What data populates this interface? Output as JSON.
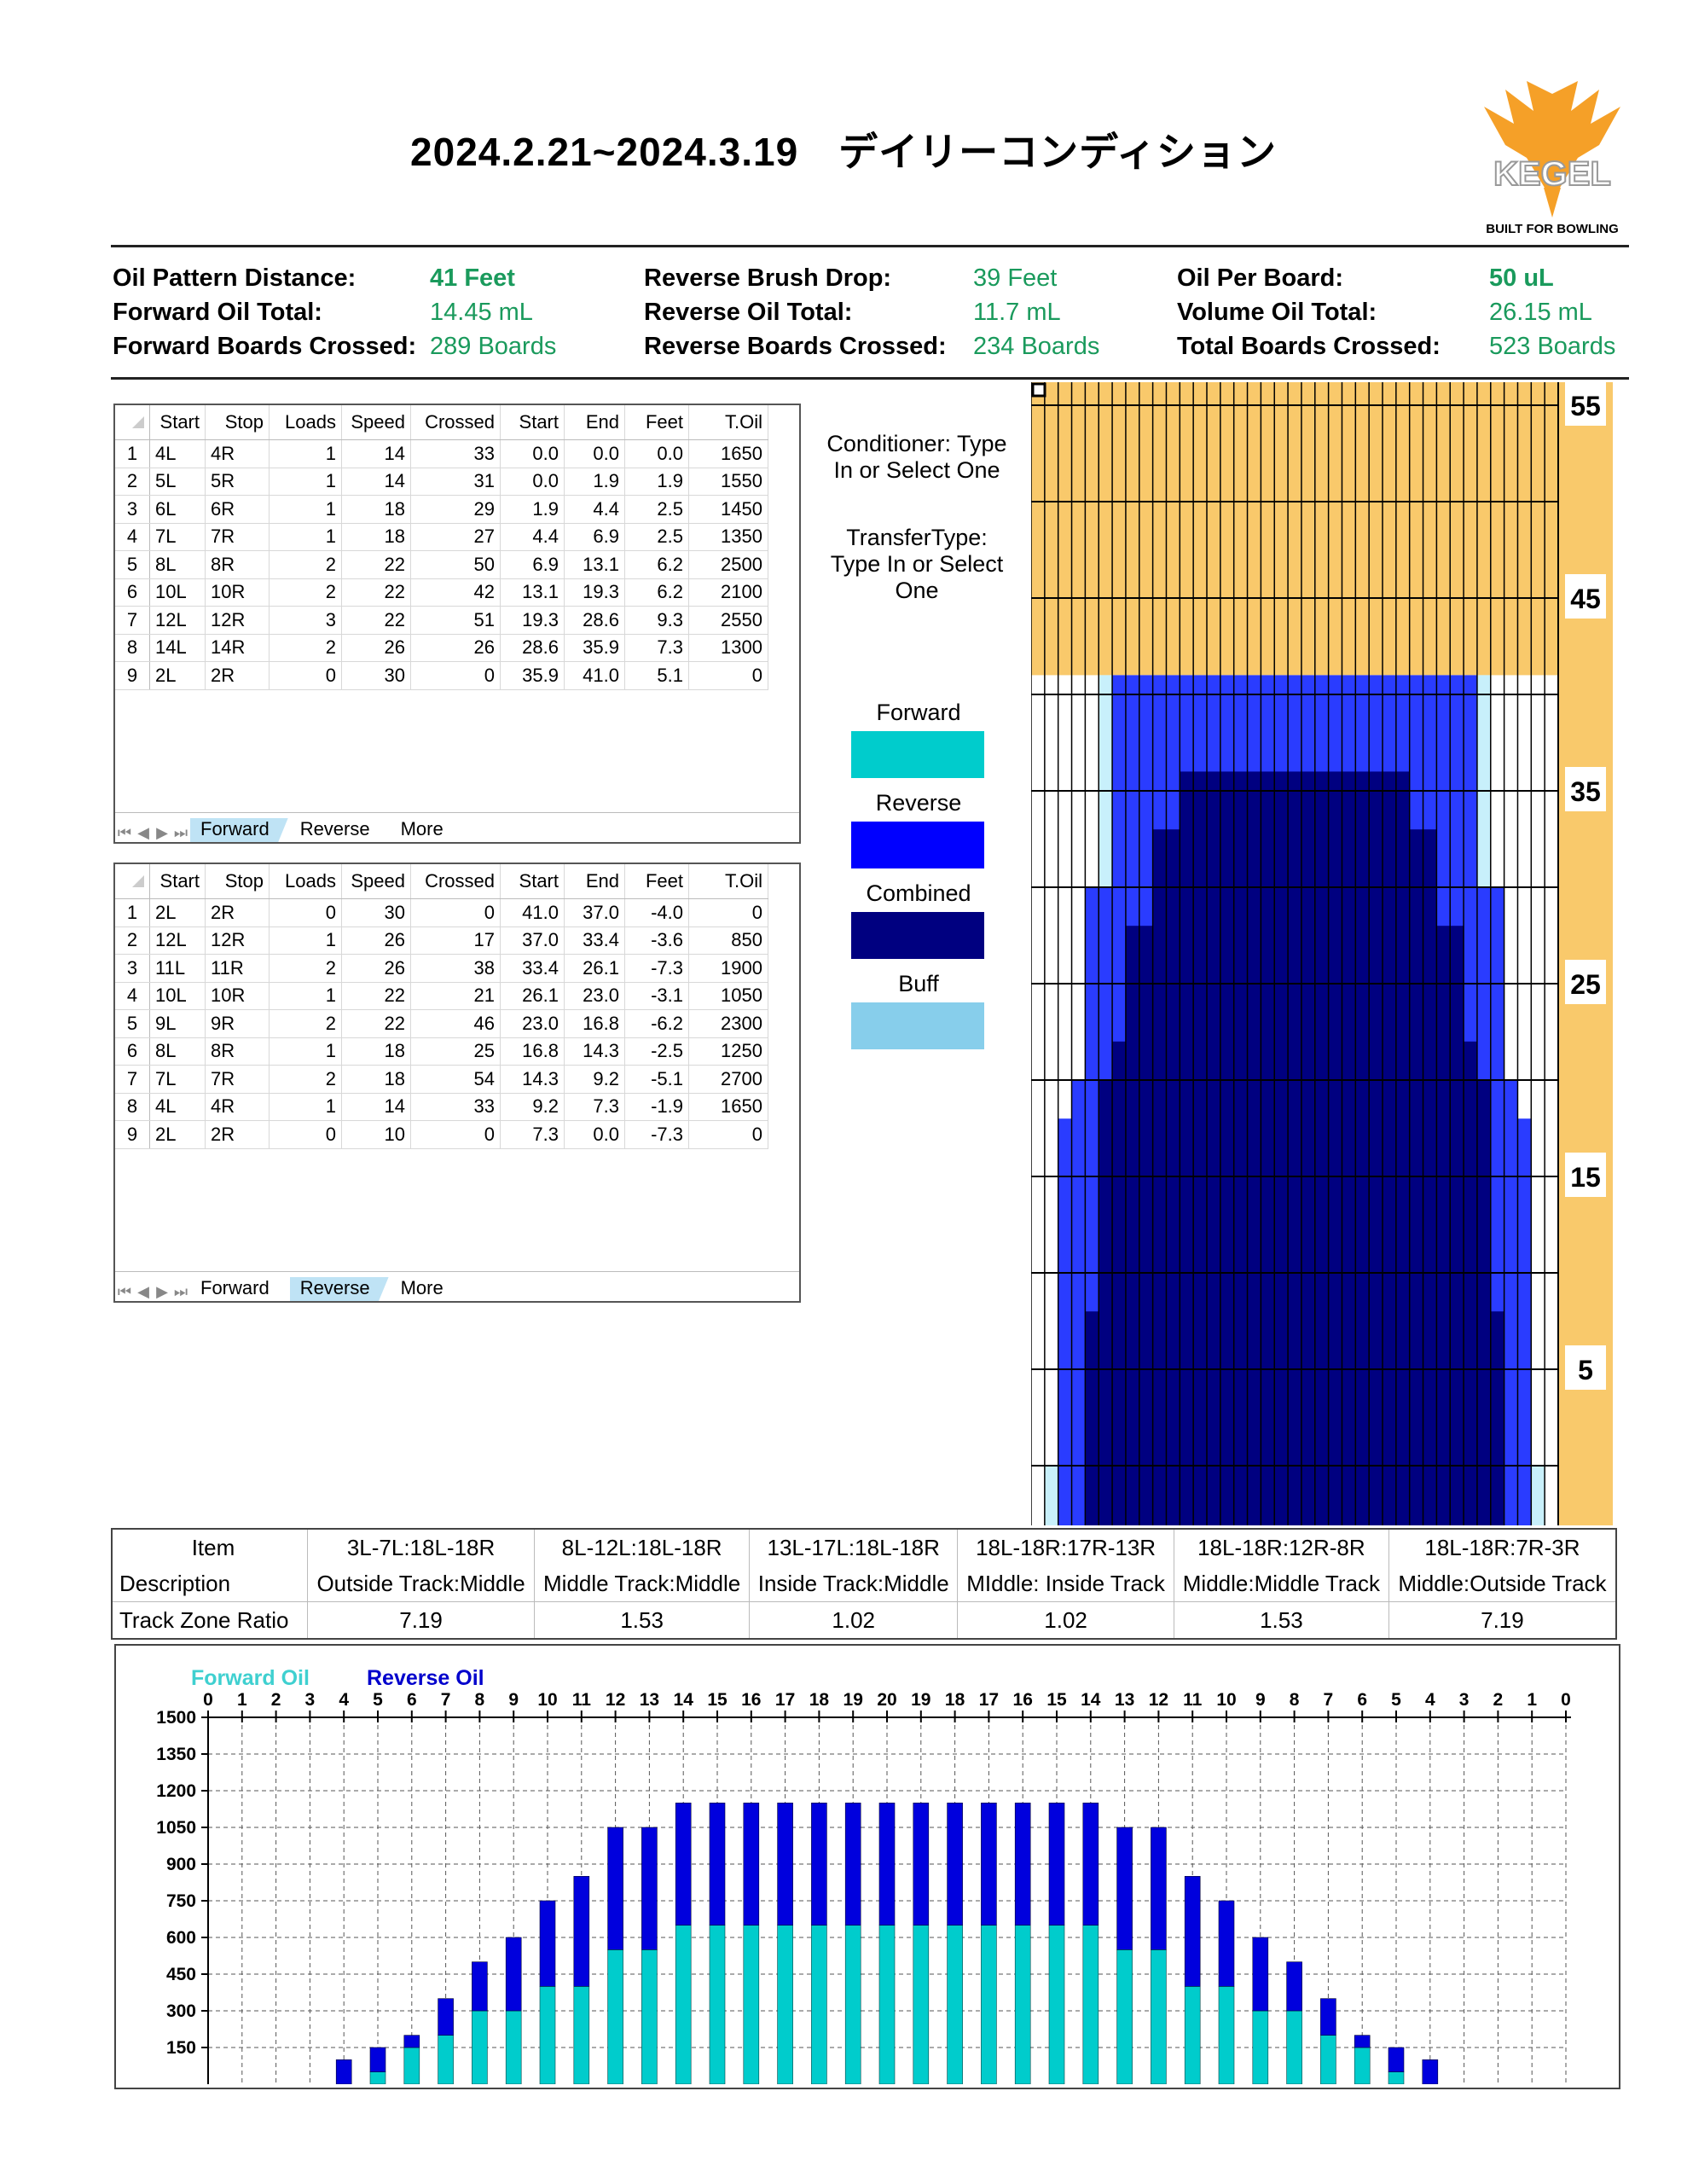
{
  "header": {
    "title": "2024.2.21~2024.3.19　デイリーコンディション",
    "logo_text": "KEGEL",
    "logo_tagline": "BUILT FOR BOWLING"
  },
  "summary": {
    "col1": [
      {
        "label": "Oil Pattern Distance:",
        "value": "41 Feet"
      },
      {
        "label": "Forward Oil Total:",
        "value": "14.45 mL"
      },
      {
        "label": "Forward Boards Crossed:",
        "value": "289 Boards"
      }
    ],
    "col2": [
      {
        "label": "Reverse Brush Drop:",
        "value": "39 Feet"
      },
      {
        "label": "Reverse Oil Total:",
        "value": "11.7 mL"
      },
      {
        "label": "Reverse Boards Crossed:",
        "value": "234 Boards"
      }
    ],
    "col3": [
      {
        "label": "Oil Per Board:",
        "value": "50 uL"
      },
      {
        "label": "Volume Oil Total:",
        "value": "26.15 mL"
      },
      {
        "label": "Total Boards Crossed:",
        "value": "523 Boards"
      }
    ]
  },
  "forward_table": {
    "headers": [
      "Start",
      "Stop",
      "Loads",
      "Speed",
      "Crossed",
      "Start",
      "End",
      "Feet",
      "T.Oil"
    ],
    "rows": [
      [
        "4L",
        "4R",
        "1",
        "14",
        "33",
        "0.0",
        "0.0",
        "0.0",
        "1650"
      ],
      [
        "5L",
        "5R",
        "1",
        "14",
        "31",
        "0.0",
        "1.9",
        "1.9",
        "1550"
      ],
      [
        "6L",
        "6R",
        "1",
        "18",
        "29",
        "1.9",
        "4.4",
        "2.5",
        "1450"
      ],
      [
        "7L",
        "7R",
        "1",
        "18",
        "27",
        "4.4",
        "6.9",
        "2.5",
        "1350"
      ],
      [
        "8L",
        "8R",
        "2",
        "22",
        "50",
        "6.9",
        "13.1",
        "6.2",
        "2500"
      ],
      [
        "10L",
        "10R",
        "2",
        "22",
        "42",
        "13.1",
        "19.3",
        "6.2",
        "2100"
      ],
      [
        "12L",
        "12R",
        "3",
        "22",
        "51",
        "19.3",
        "28.6",
        "9.3",
        "2550"
      ],
      [
        "14L",
        "14R",
        "2",
        "26",
        "26",
        "28.6",
        "35.9",
        "7.3",
        "1300"
      ],
      [
        "2L",
        "2R",
        "0",
        "30",
        "0",
        "35.9",
        "41.0",
        "5.1",
        "0"
      ]
    ],
    "tabs": [
      "Forward",
      "Reverse",
      "More"
    ],
    "active_tab": "Forward"
  },
  "reverse_table": {
    "headers": [
      "Start",
      "Stop",
      "Loads",
      "Speed",
      "Crossed",
      "Start",
      "End",
      "Feet",
      "T.Oil"
    ],
    "rows": [
      [
        "2L",
        "2R",
        "0",
        "30",
        "0",
        "41.0",
        "37.0",
        "-4.0",
        "0"
      ],
      [
        "12L",
        "12R",
        "1",
        "26",
        "17",
        "37.0",
        "33.4",
        "-3.6",
        "850"
      ],
      [
        "11L",
        "11R",
        "2",
        "26",
        "38",
        "33.4",
        "26.1",
        "-7.3",
        "1900"
      ],
      [
        "10L",
        "10R",
        "1",
        "22",
        "21",
        "26.1",
        "23.0",
        "-3.1",
        "1050"
      ],
      [
        "9L",
        "9R",
        "2",
        "22",
        "46",
        "23.0",
        "16.8",
        "-6.2",
        "2300"
      ],
      [
        "8L",
        "8R",
        "1",
        "18",
        "25",
        "16.8",
        "14.3",
        "-2.5",
        "1250"
      ],
      [
        "7L",
        "7R",
        "2",
        "18",
        "54",
        "14.3",
        "9.2",
        "-5.1",
        "2700"
      ],
      [
        "4L",
        "4R",
        "1",
        "14",
        "33",
        "9.2",
        "7.3",
        "-1.9",
        "1650"
      ],
      [
        "2L",
        "2R",
        "0",
        "10",
        "0",
        "7.3",
        "0.0",
        "-7.3",
        "0"
      ]
    ],
    "tabs": [
      "Forward",
      "Reverse",
      "More"
    ],
    "active_tab": "Reverse"
  },
  "side_text": {
    "conditioner": "Conditioner: Type In or Select One",
    "transfer": "TransferType: Type In or Select One"
  },
  "legend": [
    {
      "label": "Forward",
      "color": "#00cccc"
    },
    {
      "label": "Reverse",
      "color": "#0000ff"
    },
    {
      "label": "Combined",
      "color": "#000080"
    },
    {
      "label": "Buff",
      "color": "#87ceeb"
    }
  ],
  "lane": {
    "distance_labels": [
      "55",
      "45",
      "35",
      "25",
      "15",
      "5"
    ],
    "colors": {
      "dry": "#f9c96b",
      "light": "#ffffff",
      "buff": "#c8f0fb",
      "mid": "#2a3cff",
      "heavy": "#000080"
    }
  },
  "zone_table": {
    "rows": [
      {
        "label": "Item",
        "cells": [
          "3L-7L:18L-18R",
          "8L-12L:18L-18R",
          "13L-17L:18L-18R",
          "18L-18R:17R-13R",
          "18L-18R:12R-8R",
          "18L-18R:7R-3R"
        ]
      },
      {
        "label": "Description",
        "cells": [
          "Outside Track:Middle",
          "Middle Track:Middle",
          "Inside Track:Middle",
          "MIddle: Inside Track",
          "Middle:Middle Track",
          "Middle:Outside Track"
        ]
      },
      {
        "label": "Track Zone Ratio",
        "cells": [
          "7.19",
          "1.53",
          "1.02",
          "1.02",
          "1.53",
          "7.19"
        ]
      }
    ]
  },
  "chart_data": {
    "type": "bar",
    "legend": [
      "Forward Oil",
      "Reverse Oil"
    ],
    "categories": [
      "0",
      "1",
      "2",
      "3",
      "4",
      "5",
      "6",
      "7",
      "8",
      "9",
      "10",
      "11",
      "12",
      "13",
      "14",
      "15",
      "16",
      "17",
      "18",
      "19",
      "20",
      "19",
      "18",
      "17",
      "16",
      "15",
      "14",
      "13",
      "12",
      "11",
      "10",
      "9",
      "8",
      "7",
      "6",
      "5",
      "4",
      "3",
      "2",
      "1",
      "0"
    ],
    "series": [
      {
        "name": "Forward Oil",
        "color": "#00cccc",
        "values": [
          0,
          0,
          0,
          0,
          0,
          50,
          150,
          200,
          300,
          300,
          400,
          400,
          550,
          550,
          650,
          650,
          650,
          650,
          650,
          650,
          650,
          650,
          650,
          650,
          650,
          650,
          650,
          550,
          550,
          400,
          400,
          300,
          300,
          200,
          150,
          50,
          0,
          0,
          0,
          0,
          0
        ]
      },
      {
        "name": "Reverse Oil",
        "color": "#0000dd",
        "values": [
          0,
          0,
          0,
          0,
          100,
          100,
          50,
          150,
          200,
          300,
          350,
          450,
          500,
          500,
          500,
          500,
          500,
          500,
          500,
          500,
          500,
          500,
          500,
          500,
          500,
          500,
          500,
          500,
          500,
          450,
          350,
          300,
          200,
          150,
          50,
          100,
          100,
          0,
          0,
          0,
          0
        ]
      }
    ],
    "ylim": [
      0,
      1500
    ],
    "yticks": [
      150,
      300,
      450,
      600,
      750,
      900,
      1050,
      1200,
      1350,
      1500
    ],
    "grid": true,
    "legend_position": "top-left"
  }
}
